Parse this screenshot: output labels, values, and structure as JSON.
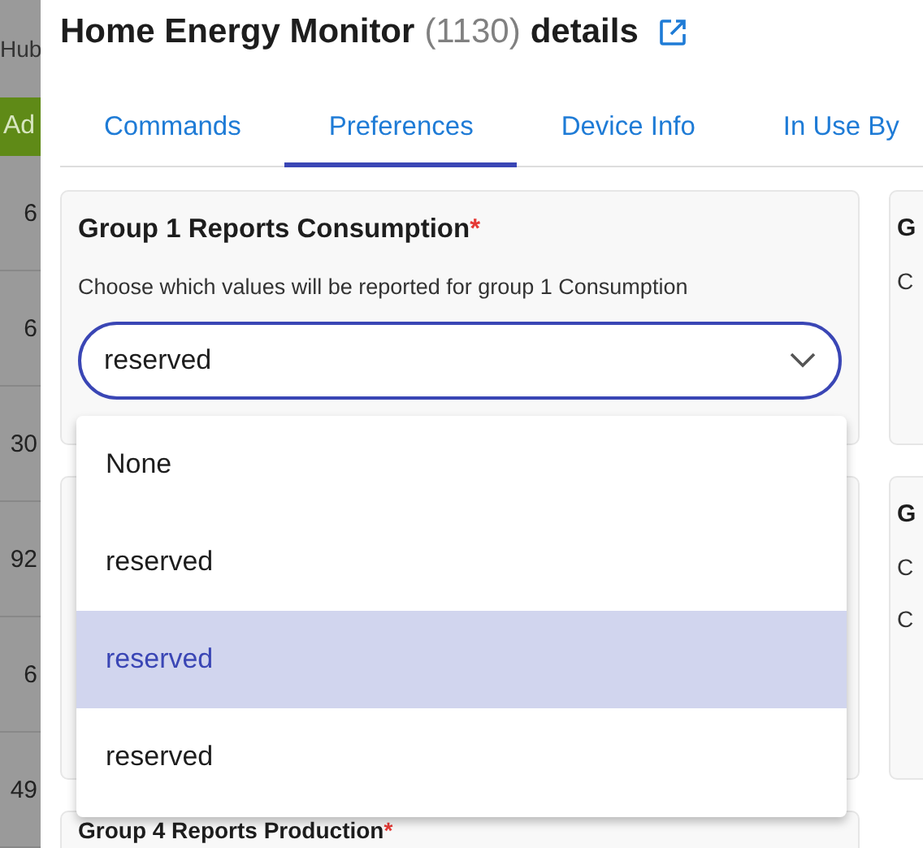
{
  "background_page": {
    "header_text": "Hub",
    "add_button": "Ad",
    "rows": [
      "6",
      "6",
      "30",
      "92",
      "6",
      "49"
    ]
  },
  "dialog": {
    "title": "Home Energy Monitor",
    "device_id": "(1130)",
    "title_suffix": "details",
    "tabs": [
      {
        "label": "Commands",
        "selected": false
      },
      {
        "label": "Preferences",
        "selected": true
      },
      {
        "label": "Device Info",
        "selected": false
      },
      {
        "label": "In Use By",
        "selected": false
      }
    ],
    "cards": [
      {
        "title": "Group 1 Reports Consumption",
        "required_mark": "*",
        "description": "Choose which values will be reported for group 1 Consumption",
        "value": "reserved",
        "focused": true
      },
      {
        "title": "Group 4 Reports Production",
        "required_mark": "*"
      }
    ],
    "side_cards": [
      {
        "title": "G",
        "lines": [
          "C"
        ]
      },
      {
        "title": "G",
        "lines": [
          "C",
          "C"
        ]
      }
    ],
    "dropdown": [
      {
        "label": "None",
        "selected": false
      },
      {
        "label": "reserved",
        "selected": false
      },
      {
        "label": "reserved",
        "selected": true
      },
      {
        "label": "reserved",
        "selected": false
      }
    ]
  }
}
